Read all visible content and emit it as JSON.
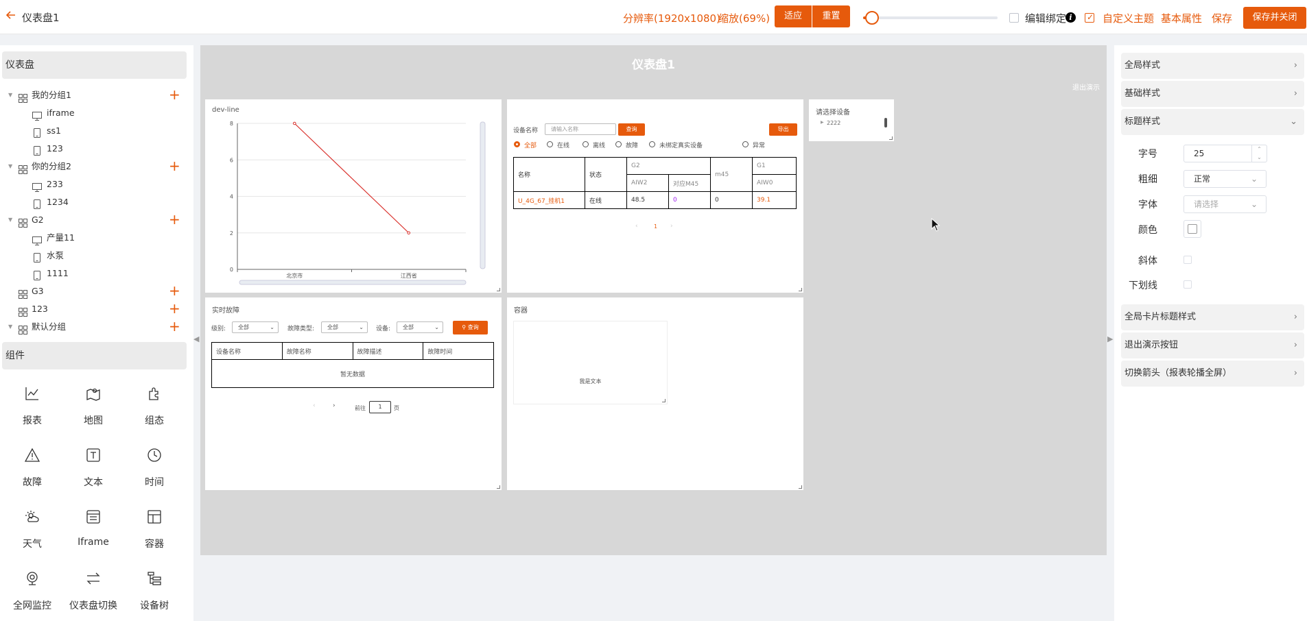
{
  "topbar": {
    "back_icon": "arrow-left-icon",
    "title": "仪表盘1",
    "resolution": "分辨率(1920x1080)",
    "zoom": "缩放(69%)",
    "fit_label": "适应",
    "reset_label": "重置",
    "zoom_slider_value": 0.05,
    "edit_binding_label": "编辑绑定",
    "edit_binding_checked": false,
    "custom_theme_label": "自定义主题",
    "custom_theme_checked": true,
    "basic_props_label": "基本属性",
    "save_label": "保存",
    "save_close_label": "保存并关闭"
  },
  "left": {
    "dashboard_header": "仪表盘",
    "tree": [
      {
        "type": "group",
        "label": "我的分组1",
        "expanded": true
      },
      {
        "type": "pc",
        "label": "iframe"
      },
      {
        "type": "mobile",
        "label": "ss1"
      },
      {
        "type": "mobile",
        "label": "123"
      },
      {
        "type": "group",
        "label": "你的分组2",
        "expanded": true
      },
      {
        "type": "pc",
        "label": "233"
      },
      {
        "type": "mobile",
        "label": "1234"
      },
      {
        "type": "group",
        "label": "G2",
        "expanded": true
      },
      {
        "type": "pc",
        "label": "产量11"
      },
      {
        "type": "mobile",
        "label": "水泵"
      },
      {
        "type": "mobile",
        "label": "1111"
      },
      {
        "type": "group",
        "label": "G3",
        "expanded": false,
        "leaf": true
      },
      {
        "type": "group",
        "label": "123",
        "expanded": false,
        "leaf": true
      },
      {
        "type": "group",
        "label": "默认分组",
        "expanded": true
      }
    ],
    "components_header": "组件",
    "components": [
      {
        "label": "报表",
        "icon": "line-chart-icon"
      },
      {
        "label": "地图",
        "icon": "map-icon"
      },
      {
        "label": "组态",
        "icon": "puzzle-icon"
      },
      {
        "label": "故障",
        "icon": "warning-icon"
      },
      {
        "label": "文本",
        "icon": "text-icon"
      },
      {
        "label": "时间",
        "icon": "clock-icon"
      },
      {
        "label": "天气",
        "icon": "weather-icon"
      },
      {
        "label": "Iframe",
        "icon": "iframe-icon"
      },
      {
        "label": "容器",
        "icon": "layout-icon"
      },
      {
        "label": "全网监控",
        "icon": "camera-icon"
      },
      {
        "label": "仪表盘切换",
        "icon": "switch-icon"
      },
      {
        "label": "设备树",
        "icon": "tree-icon"
      }
    ]
  },
  "canvas": {
    "title": "仪表盘1",
    "exit_demo": "退出演示",
    "line_card": {
      "title": "dev-line",
      "chart_data": {
        "type": "line",
        "categories": [
          "北京市",
          "江西省"
        ],
        "series": [
          {
            "values": [
              8,
              2
            ],
            "color": "#d9302b"
          }
        ],
        "yticks": [
          0,
          2,
          4,
          6,
          8
        ],
        "ylim": [
          0,
          8
        ]
      }
    },
    "table_card": {
      "device_name_label": "设备名称",
      "name_placeholder": "请输入名称",
      "query_label": "查询",
      "export_label": "导出",
      "radios": [
        "全部",
        "在线",
        "离线",
        "故障",
        "未绑定真实设备",
        "异常"
      ],
      "radio_selected": 0,
      "headers": {
        "name": "名称",
        "status": "状态",
        "g2": "G2",
        "m45": "m45",
        "g1": "G1",
        "aiw2": "AIW2",
        "m45_map": "对应M45",
        "aiw0": "AIW0"
      },
      "row": {
        "name": "U_4G_67_挂机1",
        "status": "在线",
        "aiw2": "48.5",
        "m45_map": "0",
        "m45": "0",
        "aiw0": "39.1"
      },
      "page": "1"
    },
    "device_card": {
      "title": "请选择设备",
      "item": "2222"
    },
    "fault_card": {
      "title": "实时故障",
      "level_label": "级别:",
      "level_value": "全部",
      "type_label": "故障类型:",
      "type_value": "全部",
      "device_label": "设备:",
      "device_value": "全部",
      "query_label": "查询",
      "columns": [
        "设备名称",
        "故障名称",
        "故障描述",
        "故障时间"
      ],
      "empty": "暂无数据",
      "goto_label": "前往",
      "goto_page": "1",
      "page_suffix": "页"
    },
    "container_card": {
      "title": "容器",
      "text": "我是文本"
    }
  },
  "right": {
    "sections_top": [
      {
        "label": "全局样式",
        "expanded": false
      },
      {
        "label": "基础样式",
        "expanded": false
      },
      {
        "label": "标题样式",
        "expanded": true
      }
    ],
    "fields": {
      "font_size_label": "字号",
      "font_size_value": "25",
      "weight_label": "粗细",
      "weight_value": "正常",
      "font_label": "字体",
      "font_placeholder": "请选择",
      "color_label": "颜色",
      "italic_label": "斜体",
      "underline_label": "下划线"
    },
    "sections_bottom": [
      {
        "label": "全局卡片标题样式"
      },
      {
        "label": "退出演示按钮"
      },
      {
        "label": "切换箭头（报表轮播全屏）"
      }
    ]
  }
}
